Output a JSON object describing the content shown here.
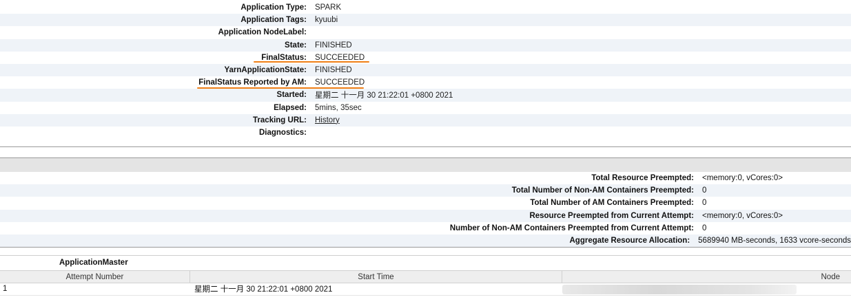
{
  "overview": {
    "rows": [
      {
        "key": "Application Type:",
        "value": "SPARK"
      },
      {
        "key": "Application Tags:",
        "value": "kyuubi"
      },
      {
        "key": "Application NodeLabel:",
        "value": ""
      },
      {
        "key": "State:",
        "value": "FINISHED"
      },
      {
        "key": "FinalStatus:",
        "value": "SUCCEEDED"
      },
      {
        "key": "YarnApplicationState:",
        "value": "FINISHED"
      },
      {
        "key": "FinalStatus Reported by AM:",
        "value": "SUCCEEDED"
      },
      {
        "key": "Started:",
        "value": "星期二 十一月 30 21:22:01 +0800 2021"
      },
      {
        "key": "Elapsed:",
        "value": "5mins, 35sec"
      },
      {
        "key": "Tracking URL:",
        "value": "History"
      },
      {
        "key": "Diagnostics:",
        "value": ""
      }
    ]
  },
  "preemption": {
    "rows": [
      {
        "key": "Total Resource Preempted:",
        "value": "<memory:0, vCores:0>"
      },
      {
        "key": "Total Number of Non-AM Containers Preempted:",
        "value": "0"
      },
      {
        "key": "Total Number of AM Containers Preempted:",
        "value": "0"
      },
      {
        "key": "Resource Preempted from Current Attempt:",
        "value": "<memory:0, vCores:0>"
      },
      {
        "key": "Number of Non-AM Containers Preempted from Current Attempt:",
        "value": "0"
      },
      {
        "key": "Aggregate Resource Allocation:",
        "value": "5689940 MB-seconds, 1633 vcore-seconds"
      }
    ]
  },
  "attempts": {
    "title": "ApplicationMaster",
    "headers": [
      "Attempt Number",
      "Start Time",
      "Node"
    ],
    "rows": [
      {
        "attempt": "1",
        "start": "星期二 十一月 30 21:22:01 +0800 2021",
        "node": ""
      }
    ]
  },
  "colors": {
    "highlight": "#f07f15",
    "stripe": "#eff3f8"
  }
}
